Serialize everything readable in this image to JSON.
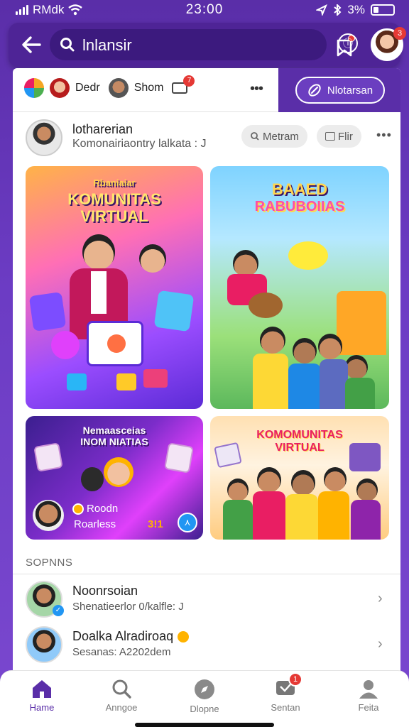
{
  "status_bar": {
    "carrier": "RMdk",
    "time": "23:00",
    "battery": "3%"
  },
  "top_bar": {
    "search_text": "lnlansir",
    "avatar_badge": "3"
  },
  "tabs": {
    "item1_label": "Dedr",
    "item2_label": "Shom",
    "notif_badge": "7",
    "pill_label": "Nlotarsan"
  },
  "creator": {
    "name": "lotharerian",
    "subtitle": "Komonairiaontry lalkata : J",
    "chip_primary": "Metram",
    "chip_secondary": "Flir"
  },
  "tiles": [
    {
      "title_small": "Rbaniaiar",
      "title_main": "KOMUNITAS",
      "title_main2": "VIRTUAL"
    },
    {
      "title_small": "BAAED",
      "title_main": "RABUBOIIAS"
    },
    {
      "title_small": "Nemaasceias",
      "title_main": "INOM NIATIAS",
      "caption_name": "Roodn",
      "caption_sub": "Roarless",
      "caption_num": "3!1"
    },
    {
      "title_small": "KOMOMUNITAS",
      "title_main": "VIRTUAL"
    }
  ],
  "section": {
    "label": "SOPNNS"
  },
  "list": [
    {
      "title": "Noonrsoian",
      "subtitle": "Shenatieerlor 0/kalfle: J"
    },
    {
      "title": "Doalka Alradiroaq",
      "subtitle": "Sesanas: A2202dem"
    }
  ],
  "nav": [
    {
      "label": "Hame",
      "icon": "home-icon",
      "active": true
    },
    {
      "label": "Anngoe",
      "icon": "search-icon"
    },
    {
      "label": "Dlopne",
      "icon": "compass-icon"
    },
    {
      "label": "Sentan",
      "icon": "chat-icon",
      "badge": "1"
    },
    {
      "label": "Feita",
      "icon": "profile-icon"
    }
  ],
  "colors": {
    "accent": "#5a2ea8",
    "badge": "#e53935"
  }
}
